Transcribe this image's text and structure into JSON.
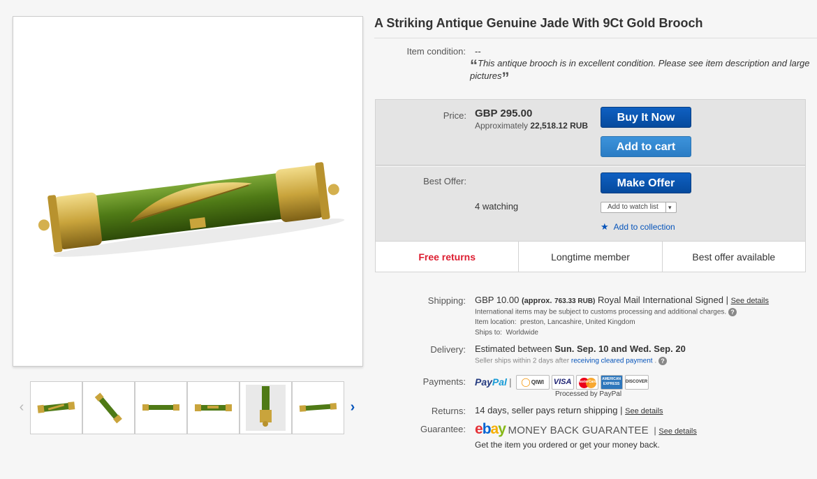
{
  "listing": {
    "title": "A Striking Antique Genuine Jade With 9Ct Gold Brooch",
    "condition_label": "Item condition:",
    "condition_value": "--",
    "condition_desc": "This antique brooch is in excellent condition. Please see item description and large pictures"
  },
  "gallery": {
    "prev_icon": "‹",
    "next_icon": "›",
    "thumbnail_count": 6
  },
  "buy": {
    "price_label": "Price:",
    "price": "GBP 295.00",
    "approx_prefix": "Approximately",
    "approx_value": "22,518.12 RUB",
    "buy_now": "Buy It Now",
    "add_to_cart": "Add to cart",
    "best_offer_label": "Best Offer:",
    "make_offer": "Make Offer",
    "watching": "4 watching",
    "watch_list": "Add to watch list",
    "add_collection": "Add to collection"
  },
  "features": [
    "Free returns",
    "Longtime member",
    "Best offer available"
  ],
  "shipping": {
    "label": "Shipping:",
    "cost": "GBP 10.00",
    "approx": "(approx.",
    "approx_value": "763.33 RUB)",
    "service": "Royal Mail International Signed |",
    "see_details": "See details",
    "note": "International items may be subject to customs processing and additional charges.",
    "location_label": "Item location:",
    "location": "preston, Lancashire, United Kingdom",
    "ships_to_label": "Ships to:",
    "ships_to": "Worldwide"
  },
  "delivery": {
    "label": "Delivery:",
    "prefix": "Estimated between",
    "dates": "Sun. Sep. 10 and Wed. Sep. 20",
    "note_prefix": "Seller ships within 2 days after",
    "note_link": "receiving cleared payment",
    "note_suffix": "."
  },
  "payments": {
    "label": "Payments:",
    "paypal_a": "Pay",
    "paypal_b": "Pal",
    "cards": [
      "QIWI",
      "VISA",
      "MasterCard",
      "AMERICAN EXPRESS",
      "DISCOVER"
    ],
    "processed": "Processed by PayPal"
  },
  "returns": {
    "label": "Returns:",
    "text": "14 days, seller pays return shipping |",
    "see_details": "See details"
  },
  "guarantee": {
    "label": "Guarantee:",
    "logo": [
      "e",
      "b",
      "a",
      "y"
    ],
    "title": "MONEY BACK GUARANTEE",
    "sep": "|",
    "see_details": "See details",
    "text": "Get the item you ordered or get your money back."
  },
  "colors": {
    "primary_button": "#0654ba",
    "secondary_button": "#3a8fd9",
    "free_returns": "#dd1e31",
    "link": "#0654ba",
    "ebay": [
      "#e53238",
      "#0064d2",
      "#f5af02",
      "#86b817"
    ]
  }
}
